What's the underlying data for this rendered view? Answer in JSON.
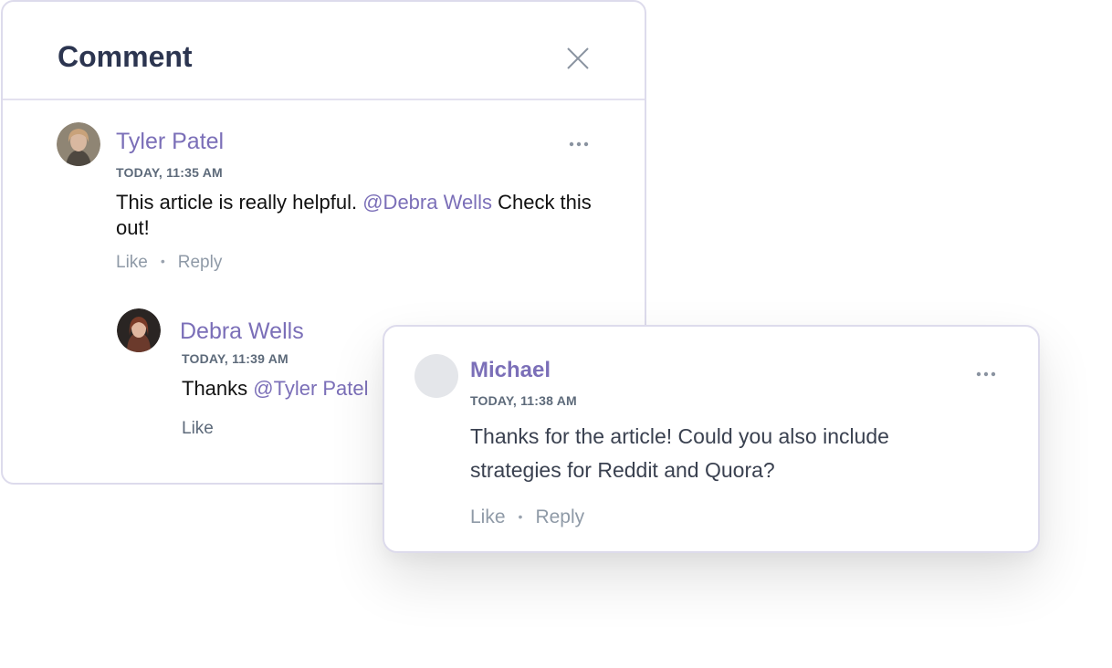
{
  "panel": {
    "title": "Comment",
    "close_icon": "close-icon"
  },
  "comment": {
    "author": "Tyler Patel",
    "time": "TODAY, 11:35 AM",
    "text_before": "This article is really helpful. ",
    "mention": "@Debra Wells",
    "text_after": " Check this out!",
    "like_label": "Like",
    "reply_label": "Reply",
    "more_icon": "more-horizontal-icon"
  },
  "reply": {
    "author": "Debra Wells",
    "time": "TODAY, 11:39 AM",
    "text_before": "Thanks ",
    "mention": "@Tyler Patel",
    "like_label": "Like"
  },
  "floating_comment": {
    "author": "Michael",
    "time": "TODAY, 11:38 AM",
    "text": "Thanks for the article! Could you also include strategies for Reddit and Quora?",
    "like_label": "Like",
    "reply_label": "Reply",
    "more_icon": "more-horizontal-icon"
  },
  "colors": {
    "accent": "#7b6fb8",
    "title": "#2c3550",
    "muted": "#8f9aa7",
    "border": "#dddbec"
  }
}
